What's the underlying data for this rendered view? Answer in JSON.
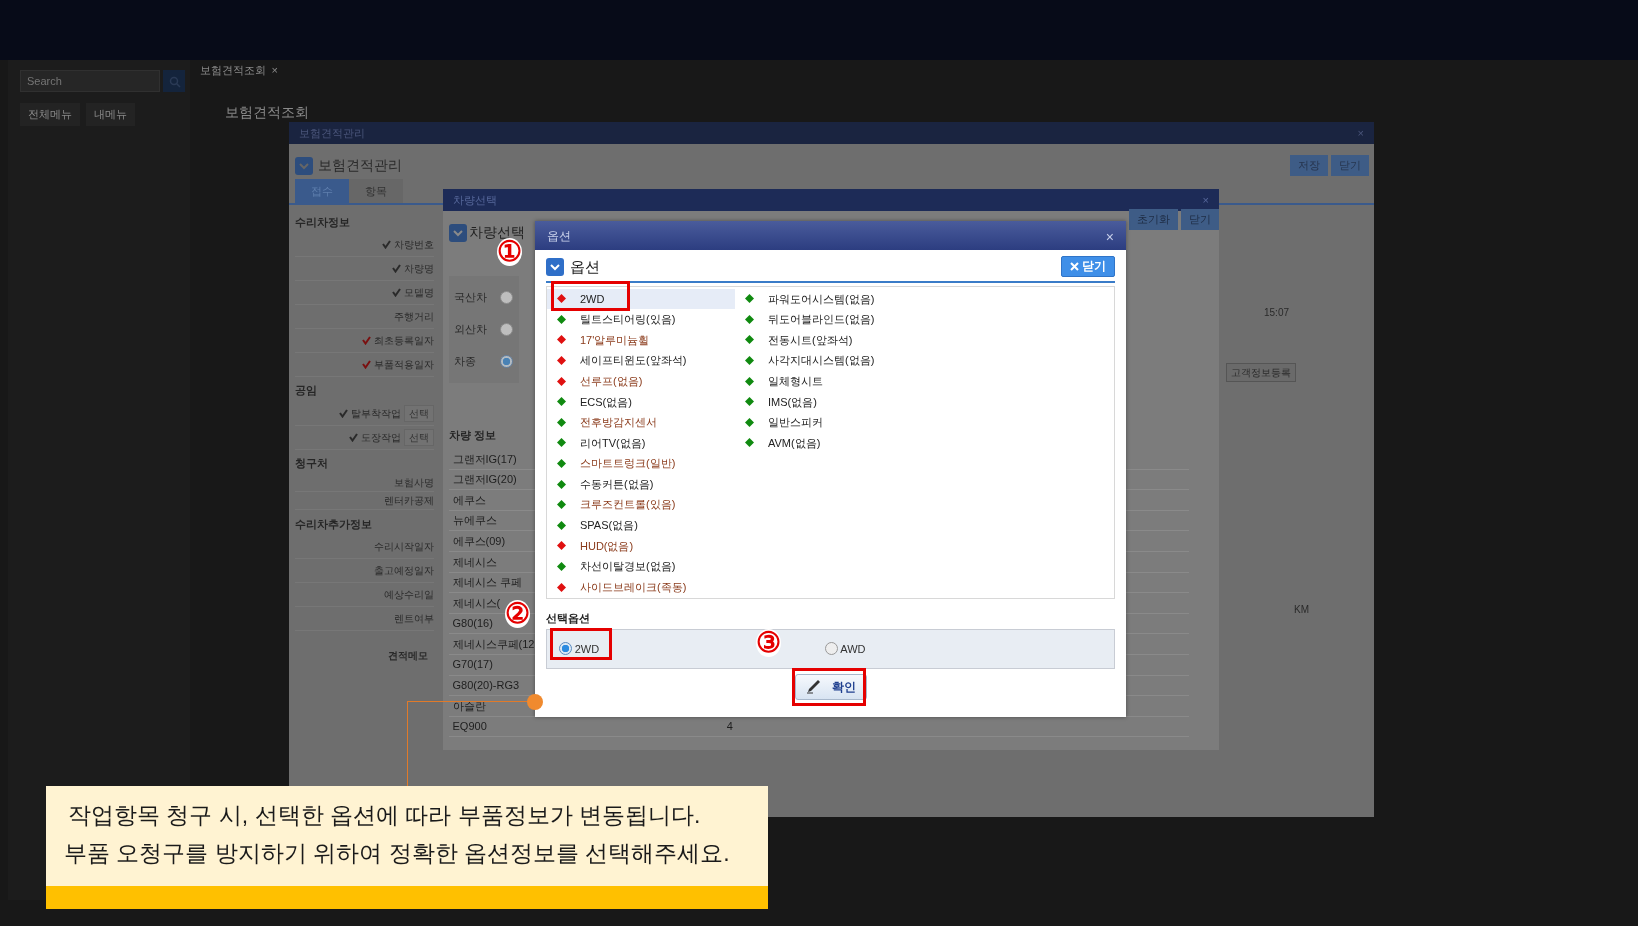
{
  "app": {
    "search": {
      "placeholder": "Search"
    },
    "menu_buttons": [
      "전체메뉴",
      "내메뉴"
    ],
    "page_tab": {
      "label": "보험견적조회",
      "close": "×"
    },
    "page_title": "보험견적조회"
  },
  "estimate_dialog": {
    "title": "보험견적관리",
    "close": "×",
    "heading": "보험견적관리",
    "buttons": [
      "저장",
      "닫기"
    ],
    "tabs": [
      {
        "label": "접수",
        "selected": true
      },
      {
        "label": "항목",
        "selected": false
      }
    ],
    "sections": [
      {
        "title": "수리차정보",
        "fields": [
          {
            "label": "차량번호",
            "required": true,
            "color": "#2a2a2a"
          },
          {
            "label": "차량명",
            "required": true,
            "color": "#2a2a2a"
          },
          {
            "label": "모델명",
            "required": true,
            "color": "#2a2a2a"
          },
          {
            "label": "주행거리",
            "required": false
          },
          {
            "label": "최초등록일자",
            "required": true,
            "color": "#7a1010"
          },
          {
            "label": "부품적용일자",
            "required": true,
            "color": "#7a1010"
          }
        ]
      },
      {
        "title": "공임",
        "fields": [
          {
            "label": "탈부착작업",
            "required": true,
            "color": "#2a2a2a",
            "button": "선택"
          },
          {
            "label": "도장작업",
            "required": true,
            "color": "#2a2a2a",
            "button": "선택"
          }
        ]
      },
      {
        "title": "청구처",
        "fields": [
          {
            "label": "보험사명",
            "required": false
          },
          {
            "label": "렌터카공제",
            "required": false
          }
        ]
      },
      {
        "title": "수리차추가정보",
        "fields": [
          {
            "label": "수리시작일자",
            "required": false
          },
          {
            "label": "출고예정일자",
            "required": false
          },
          {
            "label": "예상수리일",
            "required": false
          },
          {
            "label": "렌트여부",
            "required": false
          }
        ]
      }
    ],
    "memo_label": "견적메모",
    "time_value": "15:07",
    "customer_button": "고객정보등록",
    "distance_unit": "KM"
  },
  "vehicle_dialog": {
    "title": "차량선택",
    "close": "×",
    "heading": "차량선택",
    "buttons": [
      "초기화",
      "닫기"
    ],
    "origins": [
      {
        "label": "국산차",
        "selected": false
      },
      {
        "label": "외산차",
        "selected": false
      },
      {
        "label": "차종",
        "selected": true
      }
    ],
    "info_label": "차량 정보",
    "vehicles": [
      {
        "name": "그랜저IG(17)"
      },
      {
        "name": "그랜저IG(20)"
      },
      {
        "name": "에쿠스"
      },
      {
        "name": "뉴에쿠스"
      },
      {
        "name": "에쿠스(09)"
      },
      {
        "name": "제네시스"
      },
      {
        "name": "제네시스 쿠페"
      },
      {
        "name": "제네시스("
      },
      {
        "name": "G80(16)"
      },
      {
        "name": "제네시스쿠페(12"
      },
      {
        "name": "G70(17)"
      },
      {
        "name": "G80(20)-RG3"
      },
      {
        "name": "아슬란"
      },
      {
        "name": "EQ900",
        "count": "4"
      }
    ]
  },
  "options_dialog": {
    "title": "옵션",
    "close": "×",
    "heading": "옵션",
    "close_button": "닫기",
    "columns": [
      [
        {
          "label": "2WD",
          "color": "#e01010",
          "emphasis": false,
          "selected": true
        },
        {
          "label": "틸트스티어링(있음)",
          "color": "#108a10",
          "emphasis": false,
          "selected": false
        },
        {
          "label": "17'알루미늄휠",
          "color": "#e01010",
          "emphasis": true,
          "selected": false
        },
        {
          "label": "세이프티윈도(앞좌석)",
          "color": "#e01010",
          "emphasis": false,
          "selected": false
        },
        {
          "label": "선루프(없음)",
          "color": "#e01010",
          "emphasis": true,
          "selected": false
        },
        {
          "label": "ECS(없음)",
          "color": "#108a10",
          "emphasis": false,
          "selected": false
        },
        {
          "label": "전후방감지센서",
          "color": "#108a10",
          "emphasis": true,
          "selected": false
        },
        {
          "label": "리어TV(없음)",
          "color": "#108a10",
          "emphasis": false,
          "selected": false
        },
        {
          "label": "스마트트렁크(일반)",
          "color": "#108a10",
          "emphasis": true,
          "selected": false
        },
        {
          "label": "수동커튼(없음)",
          "color": "#108a10",
          "emphasis": false,
          "selected": false
        },
        {
          "label": "크루즈컨트롤(있음)",
          "color": "#108a10",
          "emphasis": true,
          "selected": false
        },
        {
          "label": "SPAS(없음)",
          "color": "#108a10",
          "emphasis": false,
          "selected": false
        },
        {
          "label": "HUD(없음)",
          "color": "#e01010",
          "emphasis": true,
          "selected": false
        },
        {
          "label": "차선이탈경보(없음)",
          "color": "#108a10",
          "emphasis": false,
          "selected": false
        },
        {
          "label": "사이드브레이크(족동)",
          "color": "#e01010",
          "emphasis": true,
          "selected": false
        }
      ],
      [
        {
          "label": "파워도어시스템(없음)",
          "color": "#108a10",
          "emphasis": false,
          "selected": false
        },
        {
          "label": "뒤도어블라인드(없음)",
          "color": "#108a10",
          "emphasis": false,
          "selected": false
        },
        {
          "label": "전동시트(앞좌석)",
          "color": "#108a10",
          "emphasis": false,
          "selected": false
        },
        {
          "label": "사각지대시스템(없음)",
          "color": "#108a10",
          "emphasis": false,
          "selected": false
        },
        {
          "label": "일체형시트",
          "color": "#108a10",
          "emphasis": false,
          "selected": false
        },
        {
          "label": "IMS(없음)",
          "color": "#108a10",
          "emphasis": false,
          "selected": false
        },
        {
          "label": "일반스피커",
          "color": "#108a10",
          "emphasis": false,
          "selected": false
        },
        {
          "label": "AVM(없음)",
          "color": "#108a10",
          "emphasis": false,
          "selected": false
        }
      ]
    ],
    "selected_label": "선택옵션",
    "choices": [
      {
        "label": "2WD",
        "selected": true
      },
      {
        "label": "AWD",
        "selected": false
      }
    ],
    "confirm_button": "확인"
  },
  "annotations": {
    "steps": [
      "①",
      "②",
      "③"
    ],
    "callout": [
      "작업항목 청구 시, 선택한 옵션에 따라 부품정보가 변동됩니다.",
      "부품 오청구를 방지하기 위하여 정확한 옵션정보를 선택해주세요."
    ]
  }
}
